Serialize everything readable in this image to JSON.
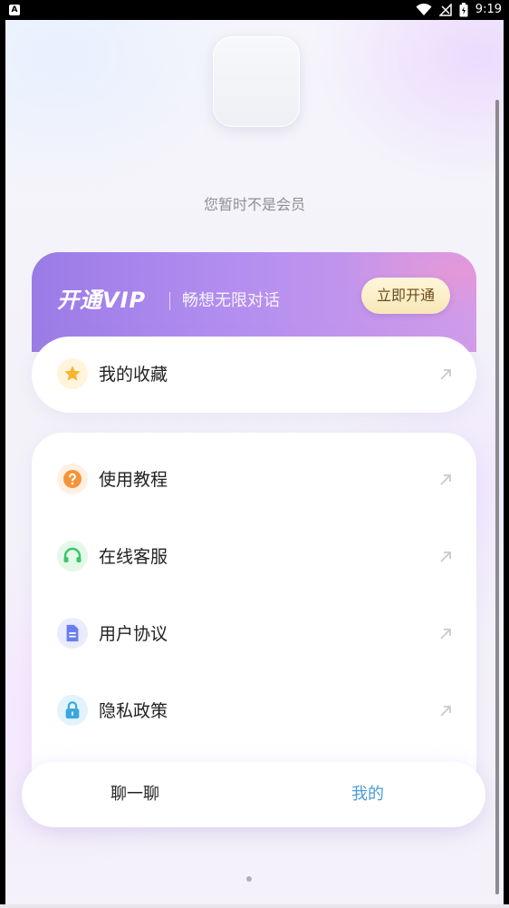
{
  "status_bar": {
    "app_glyph": "A",
    "time": "9:19",
    "icons": [
      "wifi-icon",
      "signal-icon",
      "battery-icon"
    ]
  },
  "profile": {
    "member_status": "您暂时不是会员"
  },
  "vip": {
    "title": "开通VIP",
    "slogan": "畅想无限对话",
    "button_label": "立即开通",
    "colors": {
      "gradient_start": "#9a7be6",
      "gradient_end": "#d19ce8",
      "button": "#f8e7b8"
    }
  },
  "favorites": {
    "label": "我的收藏",
    "icon": "star-icon"
  },
  "menu": {
    "items": [
      {
        "label": "使用教程",
        "icon": "question-icon"
      },
      {
        "label": "在线客服",
        "icon": "headset-icon"
      },
      {
        "label": "用户协议",
        "icon": "document-icon"
      },
      {
        "label": "隐私政策",
        "icon": "lock-icon"
      }
    ]
  },
  "bottom_nav": {
    "items": [
      {
        "label": "聊一聊",
        "active": false
      },
      {
        "label": "我的",
        "active": true
      }
    ],
    "active_color": "#4a9cd4"
  }
}
